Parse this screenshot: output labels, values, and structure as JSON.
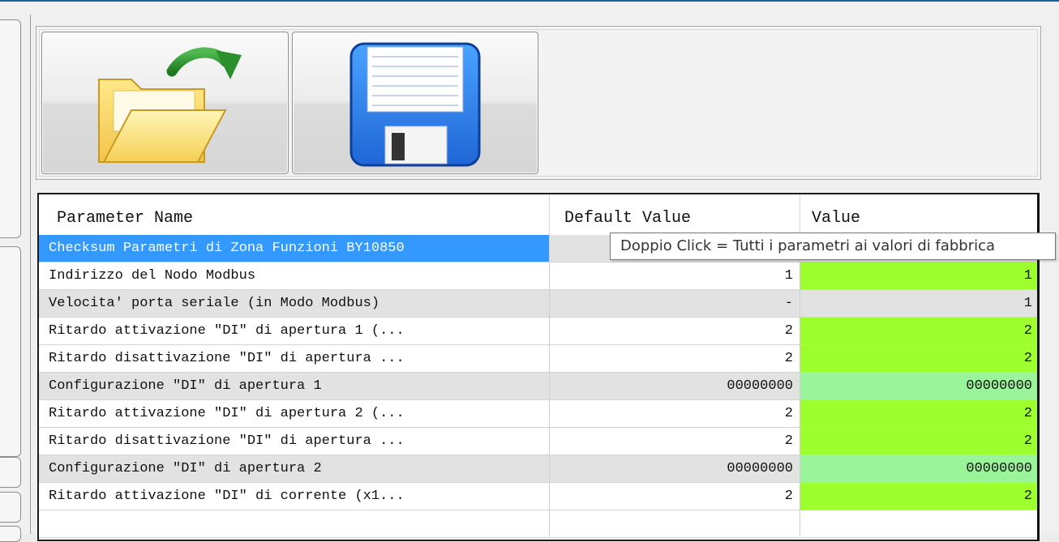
{
  "toolbar": {
    "buttons": [
      {
        "name": "open-file-button",
        "icon": "folder-open-icon"
      },
      {
        "name": "save-button",
        "icon": "floppy-disk-icon"
      }
    ]
  },
  "grid": {
    "columns": [
      "Parameter Name",
      "Default Value",
      "Value"
    ],
    "rows": [
      {
        "name": "Checksum Parametri di Zona Funzioni BY10850",
        "default": "",
        "value": "",
        "style": "sel"
      },
      {
        "name": "Indirizzo del Nodo Modbus",
        "default": "1",
        "value": "1",
        "style": "normal",
        "valueColor": "lime"
      },
      {
        "name": "Velocita' porta seriale (in Modo Modbus)",
        "default": "-",
        "value": "1",
        "style": "gray",
        "valueColor": "none"
      },
      {
        "name": "Ritardo attivazione \"DI\" di apertura 1 (...",
        "default": "2",
        "value": "2",
        "style": "normal",
        "valueColor": "lime"
      },
      {
        "name": "Ritardo disattivazione \"DI\" di apertura ...",
        "default": "2",
        "value": "2",
        "style": "normal",
        "valueColor": "lime"
      },
      {
        "name": "Configurazione \"DI\" di apertura 1",
        "default": "00000000",
        "value": "00000000",
        "style": "gray",
        "valueColor": "mint"
      },
      {
        "name": "Ritardo attivazione \"DI\" di apertura 2 (...",
        "default": "2",
        "value": "2",
        "style": "normal",
        "valueColor": "lime"
      },
      {
        "name": "Ritardo disattivazione \"DI\" di apertura ...",
        "default": "2",
        "value": "2",
        "style": "normal",
        "valueColor": "lime"
      },
      {
        "name": "Configurazione \"DI\" di apertura 2",
        "default": "00000000",
        "value": "00000000",
        "style": "gray",
        "valueColor": "mint"
      },
      {
        "name": "Ritardo attivazione \"DI\" di corrente (x1...",
        "default": "2",
        "value": "2",
        "style": "normal",
        "valueColor": "lime"
      },
      {
        "name": "",
        "default": "",
        "value": "",
        "style": "normal",
        "valueColor": "none"
      }
    ]
  },
  "tooltip": {
    "text": "Doppio Click = Tutti i parametri ai valori di fabbrica"
  },
  "colors": {
    "selection": "#3399ff",
    "value_lime": "#9dff2e",
    "value_mint": "#9af59a",
    "row_gray": "#e2e2e2",
    "title_border": "#1f5f9e"
  }
}
